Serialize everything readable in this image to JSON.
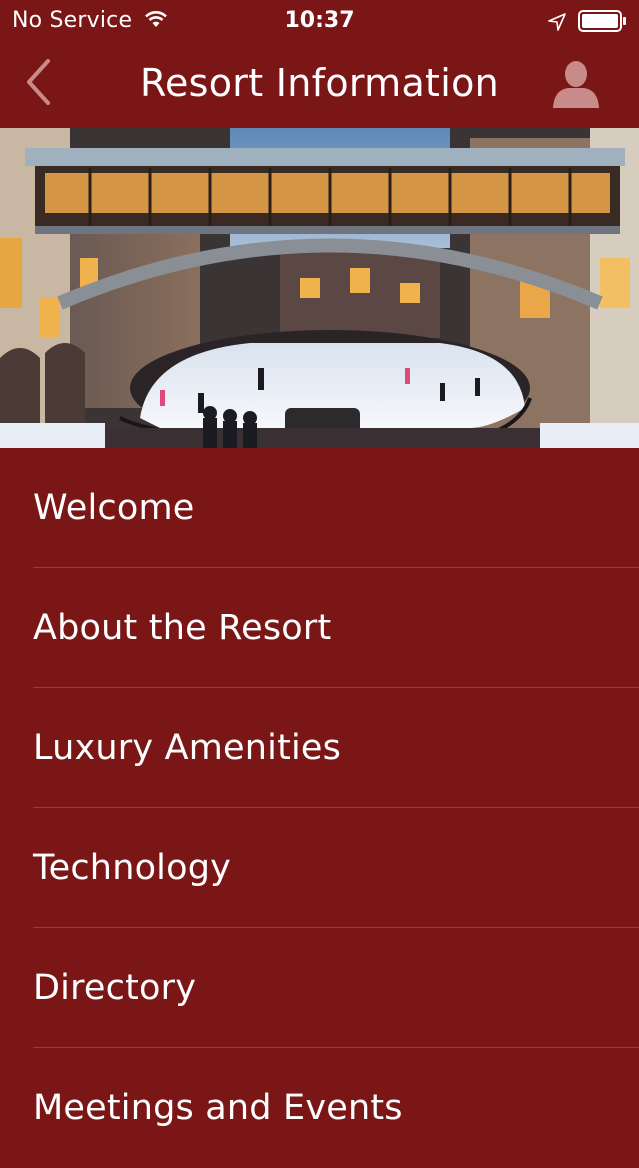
{
  "status_bar": {
    "carrier": "No Service",
    "time": "10:37"
  },
  "nav": {
    "title": "Resort Information",
    "back_icon": "chevron-left-icon",
    "profile_icon": "person-icon"
  },
  "hero": {
    "icon": "photo-ice-rink"
  },
  "menu": {
    "items": [
      {
        "label": "Welcome"
      },
      {
        "label": "About the Resort"
      },
      {
        "label": "Luxury Amenities"
      },
      {
        "label": "Technology"
      },
      {
        "label": "Directory"
      },
      {
        "label": "Meetings and Events"
      }
    ]
  },
  "colors": {
    "background": "#7b1616",
    "text": "#ffffff",
    "nav_icon": "#c98a8a"
  }
}
